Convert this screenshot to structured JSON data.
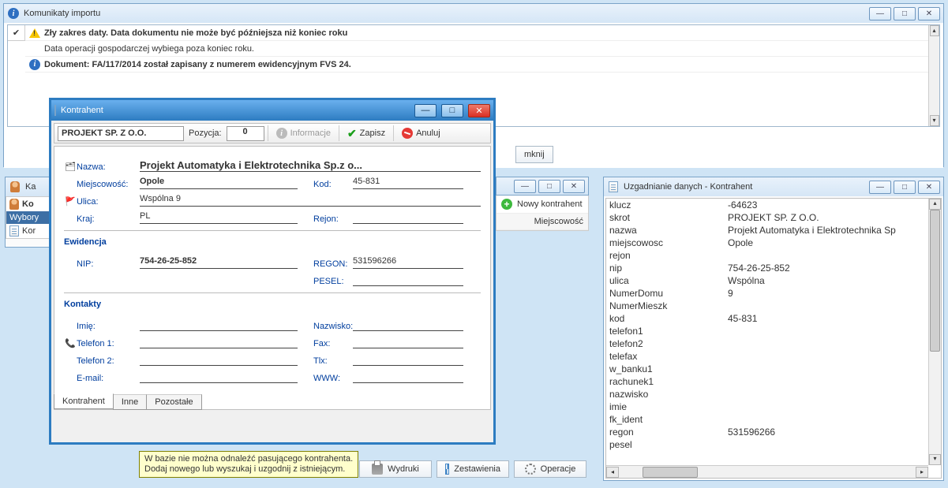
{
  "importWin": {
    "title": "Komunikaty importu",
    "messages": [
      {
        "icon": "warn",
        "bold": true,
        "text": "Zły zakres daty. Data dokumentu nie może być późniejsza niż koniec roku"
      },
      {
        "icon": "",
        "bold": false,
        "text": "Data operacji gospodarczej wybiega poza koniec roku."
      },
      {
        "icon": "info",
        "bold": true,
        "text": "Dokument: FA/117/2014 został zapisany z numerem ewidencyjnym FVS          24."
      }
    ],
    "closeBtn": "mknij"
  },
  "kaWin": {
    "title": "Ka",
    "row1": "Ko",
    "rowSelected": "Wybory",
    "row2": "Kor"
  },
  "kontrWin": {
    "title": "Kontrahent",
    "toolbar": {
      "name": "PROJEKT SP. Z O.O.",
      "posLabel": "Pozycja:",
      "posValue": "0",
      "info": "Informacje",
      "save": "Zapisz",
      "cancel": "Anuluj"
    },
    "form": {
      "nazwaLbl": "Nazwa:",
      "nazwa": "Projekt Automatyka i Elektrotechnika Sp.z o...",
      "miejscLbl": "Miejscowość:",
      "miejsc": "Opole",
      "kodLbl": "Kod:",
      "kod": "45-831",
      "ulicaLbl": "Ulica:",
      "ulica": "Wspólna 9",
      "krajLbl": "Kraj:",
      "kraj": "PL",
      "rejonLbl": "Rejon:",
      "rejon": "",
      "ewidencja": "Ewidencja",
      "nipLbl": "NIP:",
      "nip": "754-26-25-852",
      "regonLbl": "REGON:",
      "regon": "531596266",
      "peselLbl": "PESEL:",
      "pesel": "",
      "kontakty": "Kontakty",
      "imieLbl": "Imię:",
      "nazwiskoLbl": "Nazwisko:",
      "tel1Lbl": "Telefon 1:",
      "faxLbl": "Fax:",
      "tel2Lbl": "Telefon 2:",
      "tlxLbl": "Tlx:",
      "emailLbl": "E-mail:",
      "wwwLbl": "WWW:"
    },
    "tabs": {
      "t1": "Kontrahent",
      "t2": "Inne",
      "t3": "Pozostałe"
    }
  },
  "tooltip": {
    "line1": "W bazie nie można odnaleźć pasującego  kontrahenta.",
    "line2": "Dodaj nowego lub wyszukaj i uzgodnij z istniejącym."
  },
  "bottomBtns": {
    "b1": "Wydruki",
    "b2": "Zestawienia",
    "b3": "Operacje"
  },
  "nkStrip": {
    "item1": "Nowy kontrahent",
    "item2": "Miejscowość"
  },
  "uzWin": {
    "title": "Uzgadnianie danych - Kontrahent",
    "rows": [
      [
        "klucz",
        "-64623"
      ],
      [
        "skrot",
        "PROJEKT SP. Z O.O."
      ],
      [
        "nazwa",
        "Projekt Automatyka i Elektrotechnika Sp"
      ],
      [
        "miejscowosc",
        "Opole"
      ],
      [
        "rejon",
        ""
      ],
      [
        "nip",
        "754-26-25-852"
      ],
      [
        "ulica",
        "Wspólna"
      ],
      [
        "NumerDomu",
        "9"
      ],
      [
        "NumerMieszk",
        ""
      ],
      [
        "kod",
        "45-831"
      ],
      [
        "telefon1",
        ""
      ],
      [
        "telefon2",
        ""
      ],
      [
        "telefax",
        ""
      ],
      [
        "w_banku1",
        ""
      ],
      [
        "rachunek1",
        ""
      ],
      [
        "nazwisko",
        ""
      ],
      [
        "imie",
        ""
      ],
      [
        "fk_ident",
        ""
      ],
      [
        "regon",
        "531596266"
      ],
      [
        "pesel",
        ""
      ]
    ]
  }
}
